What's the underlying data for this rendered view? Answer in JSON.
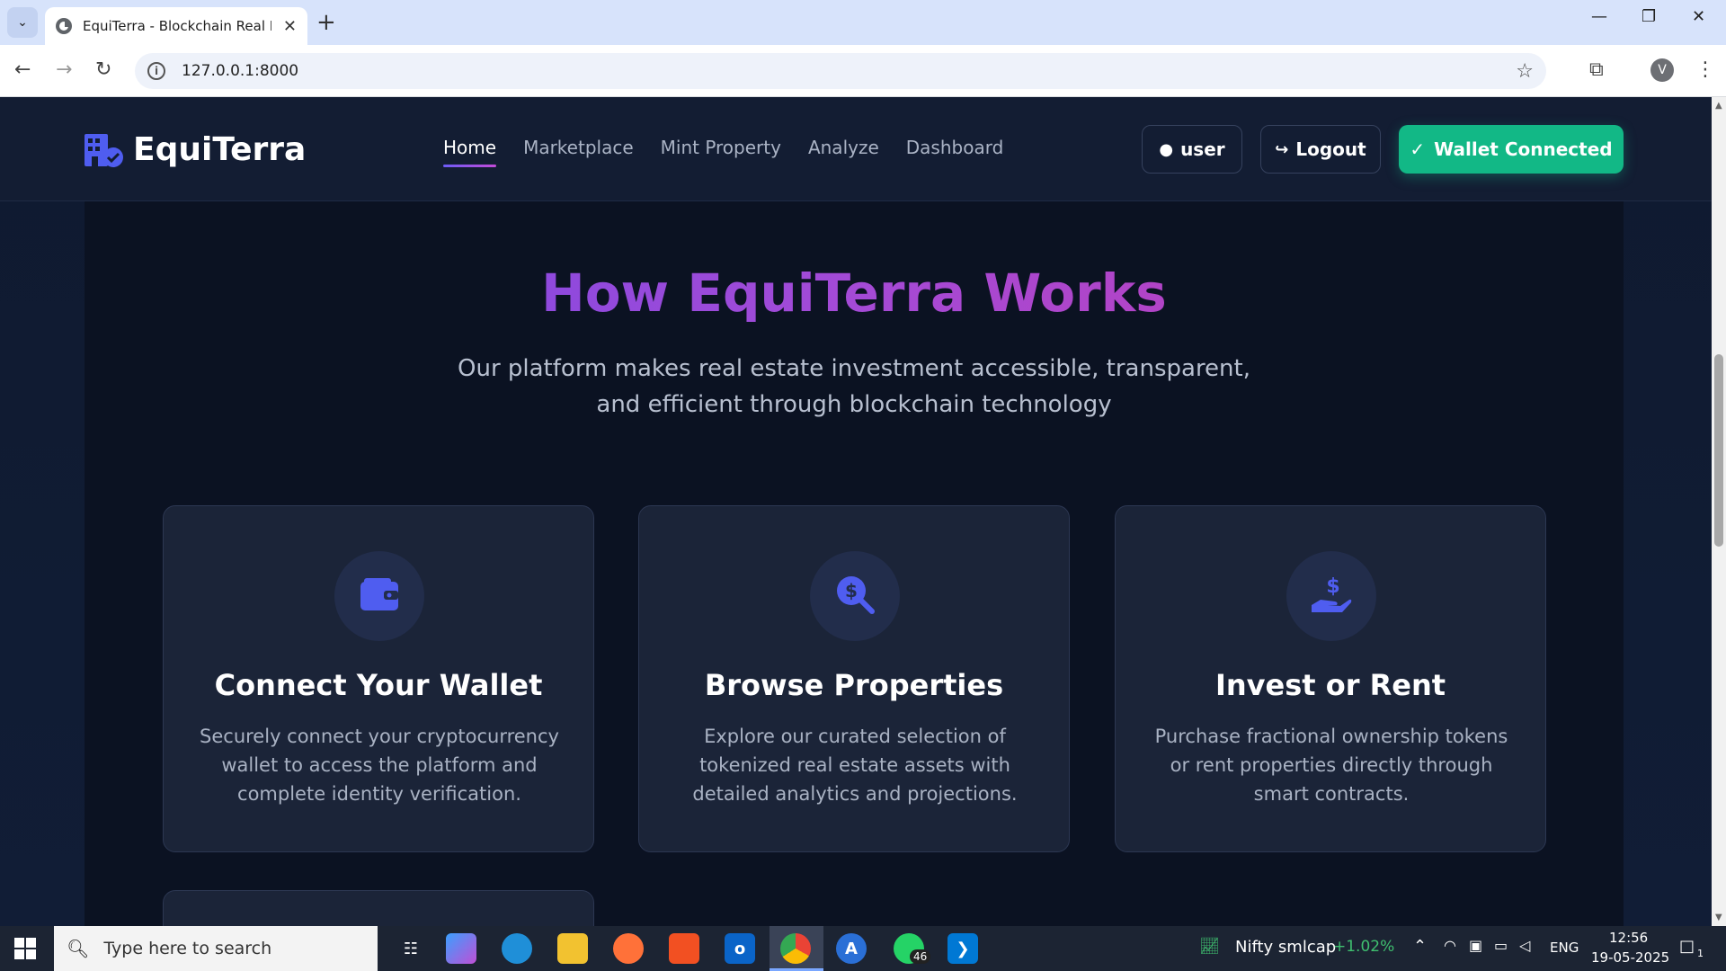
{
  "browser": {
    "tab_title": "EquiTerra - Blockchain Real Esta",
    "url": "127.0.0.1:8000",
    "profile_initial": "V"
  },
  "site": {
    "brand": "EquiTerra",
    "nav": [
      {
        "label": "Home",
        "active": true
      },
      {
        "label": "Marketplace",
        "active": false
      },
      {
        "label": "Mint Property",
        "active": false
      },
      {
        "label": "Analyze",
        "active": false
      },
      {
        "label": "Dashboard",
        "active": false
      }
    ],
    "user_label": "user",
    "logout_label": "Logout",
    "wallet_label": "Wallet Connected",
    "colors": {
      "accent": "#12b886",
      "brand_blue": "#4f5df0",
      "title_gradient_start": "#7048e8",
      "title_gradient_end": "#c53bb0"
    }
  },
  "section": {
    "title": "How EquiTerra Works",
    "subtitle_line1": "Our platform makes real estate investment accessible, transparent,",
    "subtitle_line2": "and efficient through blockchain technology",
    "cards": [
      {
        "icon": "wallet-icon",
        "title": "Connect Your Wallet",
        "desc_lines": [
          "Securely connect your cryptocurrency",
          "wallet to access the platform and",
          "complete identity verification."
        ]
      },
      {
        "icon": "search-dollar-icon",
        "title": "Browse Properties",
        "desc_lines": [
          "Explore our curated selection of",
          "tokenized real estate assets with",
          "detailed analytics and projections."
        ]
      },
      {
        "icon": "hand-holding-dollar-icon",
        "title": "Invest or Rent",
        "desc_lines": [
          "Purchase fractional ownership tokens",
          "or rent properties directly through",
          "smart contracts."
        ]
      }
    ]
  },
  "taskbar": {
    "search_placeholder": "Type here to search",
    "whatsapp_badge": "46",
    "stock_name": "Nifty smlcap",
    "stock_change": "+1.02%",
    "language": "ENG",
    "time": "12:56",
    "date": "19-05-2025",
    "notifications": "1"
  }
}
